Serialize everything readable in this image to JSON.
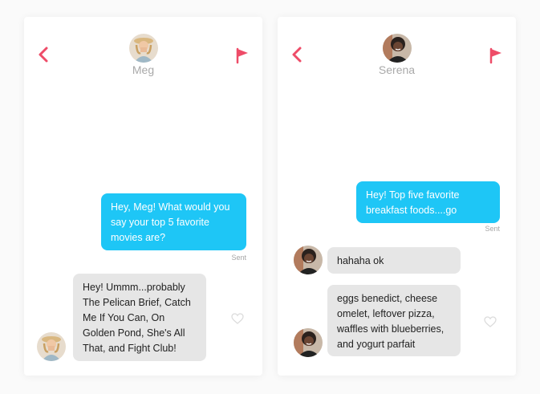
{
  "colors": {
    "accent": "#ee4c68",
    "sent_bubble": "#1ec6f6",
    "received_bubble": "#e6e6e6"
  },
  "left_chat": {
    "contact_name": "Meg",
    "avatar_icon": "avatar-meg",
    "messages": [
      {
        "direction": "sent",
        "text": "Hey, Meg! What would you say your top 5 favorite movies are?",
        "status": "Sent"
      },
      {
        "direction": "received",
        "text": "Hey! Ummm...probably The Pelican Brief, Catch Me If You Can, On Golden Pond, She's All That, and Fight Club!"
      }
    ]
  },
  "right_chat": {
    "contact_name": "Serena",
    "avatar_icon": "avatar-serena",
    "messages": [
      {
        "direction": "sent",
        "text": "Hey! Top five favorite breakfast foods....go",
        "status": "Sent"
      },
      {
        "direction": "received",
        "text": "hahaha ok"
      },
      {
        "direction": "received",
        "text": "eggs benedict, cheese omelet, leftover pizza, waffles with blueberries, and yogurt parfait"
      }
    ]
  }
}
